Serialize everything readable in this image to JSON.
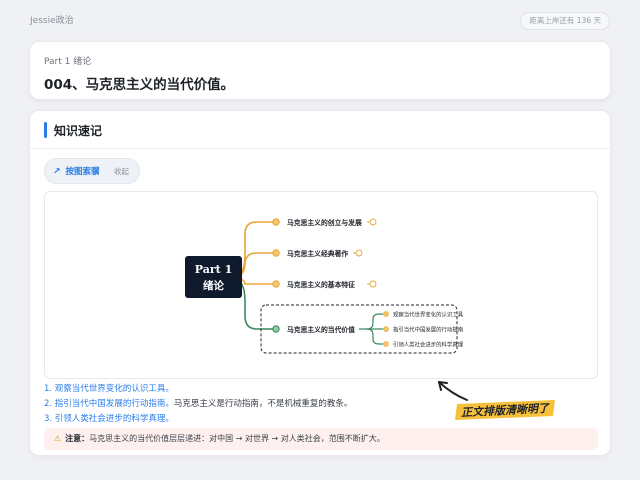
{
  "topbar": {
    "brand": "Jessie政治",
    "countdown": "距离上岸还有 136 天"
  },
  "header": {
    "part": "Part 1 绪论",
    "title": "004、马克思主义的当代价值。"
  },
  "section": {
    "title": "知识速记",
    "pill_button": "按图索骥",
    "collapse": "收起"
  },
  "mindmap": {
    "root_line1": "Part 1",
    "root_line2": "绪论",
    "branches": [
      "马克思主义的创立与发展",
      "马克思主义经典著作",
      "马克思主义的基本特征",
      "马克思主义的当代价值"
    ],
    "sub_branches": [
      "观察当代世界变化的认识工具",
      "指引当代中国发展的行动指南",
      "引领人类社会进步的科学真理"
    ],
    "colors": {
      "orange": "#e8a53a",
      "green": "#3a8a5e",
      "root_bg": "#0f1b2d"
    }
  },
  "list": [
    {
      "blue": "1. 观察当代世界变化的认识工具。",
      "dark": ""
    },
    {
      "blue": "2. 指引当代中国发展的行动指南。",
      "dark": "马克思主义是行动指南，不是机械重复的教条。"
    },
    {
      "blue": "3. 引领人类社会进步的科学真理。",
      "dark": ""
    }
  ],
  "note": {
    "label": "注意：",
    "text": "马克思主义的当代价值层层递进：对中国 → 对世界 → 对人类社会，范围不断扩大。"
  },
  "sticker": {
    "text": "正文排版清晰明了"
  }
}
